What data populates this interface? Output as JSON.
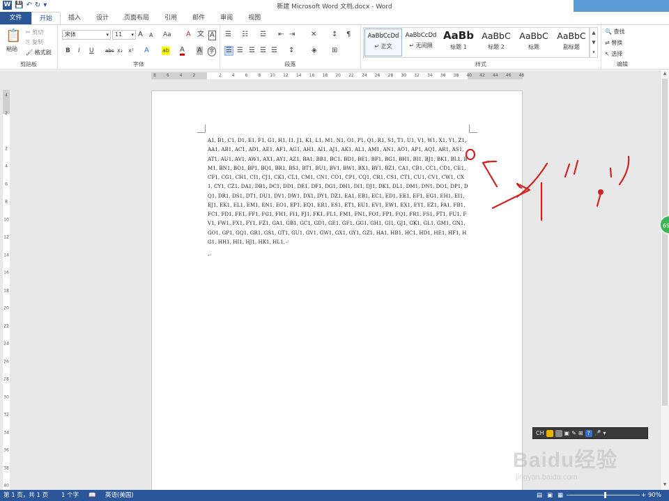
{
  "window": {
    "title": "新建 Microsoft Word 文档.docx - Word",
    "app_icon": "W",
    "qat_save": "💾",
    "qat_undo": "↶",
    "qat_redo": "↻",
    "qat_more": "▾"
  },
  "tabs": [
    "文件",
    "开始",
    "插入",
    "设计",
    "页面布局",
    "引用",
    "邮件",
    "审阅",
    "视图"
  ],
  "active_tab": "开始",
  "ribbon": {
    "clipboard": {
      "label": "剪贴板",
      "paste": "粘贴",
      "paste_icon": "📋",
      "cut": "剪切",
      "copy": "复制",
      "format_painter": "格式刷"
    },
    "font": {
      "label": "字体",
      "font_name": "宋体",
      "font_size": "11",
      "grow": "A",
      "shrink": "A",
      "case": "Aa",
      "clear": "A",
      "wen": "文",
      "box": "A",
      "bold": "B",
      "italic": "I",
      "underline": "U",
      "strike": "abc",
      "subscript": "x₂",
      "superscript": "x²",
      "effects": "A",
      "highlight": "ab",
      "font_color": "A",
      "shade": "A",
      "enclose": "字"
    },
    "paragraph": {
      "label": "段落",
      "bullets": "☰",
      "numbering": "☷",
      "multilevel": "☲",
      "indent_dec": "⇤",
      "indent_inc": "⇥",
      "chinese_layout": "✕",
      "sort": "↕",
      "show_marks": "¶",
      "align_left": "☰",
      "center": "☰",
      "align_right": "☰",
      "justify": "☰",
      "distributed": "☰",
      "spacing": "↕",
      "shading": "◈",
      "borders": "⊞"
    },
    "styles": {
      "label": "样式",
      "items": [
        {
          "sample": "AaBbCcDd",
          "name": "↵ 正文"
        },
        {
          "sample": "AaBbCcDd",
          "name": "↵ 无间隔"
        },
        {
          "sample": "AaBb",
          "name": "标题 1"
        },
        {
          "sample": "AaBbC",
          "name": "标题 2"
        },
        {
          "sample": "AaBbC",
          "name": "标题"
        },
        {
          "sample": "AaBbC",
          "name": "副标题"
        }
      ],
      "scroll_up": "▲",
      "scroll_down": "▼",
      "more": "▾"
    },
    "editing": {
      "label": "编辑",
      "find": "查找",
      "replace": "替换",
      "select": "选择"
    }
  },
  "ruler": {
    "h_ticks": [
      "8",
      "6",
      "4",
      "2",
      "",
      "2",
      "4",
      "6",
      "8",
      "10",
      "12",
      "14",
      "16",
      "18",
      "20",
      "22",
      "24",
      "26",
      "28",
      "30",
      "32",
      "34",
      "36",
      "38",
      "40",
      "42",
      "44",
      "46",
      "48"
    ],
    "v_ticks": [
      "4",
      "2",
      "",
      "2",
      "4",
      "6",
      "8",
      "10",
      "12",
      "14",
      "16",
      "18",
      "20",
      "22",
      "24",
      "26",
      "28",
      "30",
      "32",
      "34",
      "36",
      "38",
      "40",
      "42",
      "44"
    ]
  },
  "document": {
    "body": "A1, B1, C1, D1, E1, F1, G1, H1, I1, J1, K1, L1, M1, N1, O1, P1, Q1, R1, S1, T1, U1, V1, W1, X1, Y1, Z1, AA1, AB1, AC1, AD1, AE1, AF1, AG1, AH1, AI1, AJ1, AK1, AL1, AM1, AN1, AO1, AP1, AQ1, AR1, AS1, AT1, AU1, AV1, AW1, AX1, AY1, AZ1, BA1, BB1, BC1, BD1, BE1, BF1, BG1, BH1, BI1, BJ1, BK1, BL1, BM1, BN1, BO1, BP1, BQ1, BR1, BS1, BT1, BU1, BV1, BW1, BX1, BY1, BZ1, CA1, CB1, CC1, CD1, CE1, CF1, CG1, CH1, CI1, CJ1, CK1, CL1, CM1, CN1, CO1, CP1, CQ1, CR1, CS1, CT1, CU1, CV1, CW1, CX1, CY1, CZ1, DA1, DB1, DC1, DD1, DE1, DF1, DG1, DH1, DI1, DJ1, DK1, DL1, DM1, DN1, DO1, DP1, DQ1, DR1, DS1, DT1, DU1, DV1, DW1, DX1, DY1, DZ1, EA1, EB1, EC1, ED1, EE1, EF1, EG1, EH1, EI1, EJ1, EK1, EL1, EM1, EN1, EO1, EP1, EQ1, ER1, ES1, ET1, EU1, EV1, EW1, EX1, EY1, EZ1, FA1, FB1, FC1, FD1, FE1, FF1, FG1, FH1, FI1, FJ1, FK1, FL1, FM1, FN1, FO1, FP1, FQ1, FR1, FS1, FT1, FU1, FV1, FW1, FX1, FY1, FZ1, GA1, GB1, GC1, GD1, GE1, GF1, GG1, GH1, GI1, GJ1, GK1, GL1, GM1, GN1, GO1, GP1, GQ1, GR1, GS1, GT1, GU1, GV1, GW1, GX1, GY1, GZ1, HA1, HB1, HC1, HD1, HE1, HF1, HG1, HH1, HI1, HJ1, HK1, HL1,",
    "para_mark": "↵",
    "end_mark": "↵"
  },
  "scrollbar": {
    "up": "▲",
    "down": "▼"
  },
  "overlay": {
    "badge_text": "69",
    "ime_items": [
      "CH",
      "▣",
      "✎",
      "⊞",
      "?",
      "🎤",
      "▾"
    ]
  },
  "watermark": {
    "main": "Baidu经验",
    "sub": "jingyan.baidu.com"
  },
  "status": {
    "page": "第 1 页，共 1 页",
    "words": "1 个字",
    "proof_icon": "📖",
    "language": "英语(美国)",
    "zoom": "90%",
    "zoom_minus": "−",
    "zoom_plus": "+"
  },
  "annotation": {
    "color": "#d42020"
  }
}
